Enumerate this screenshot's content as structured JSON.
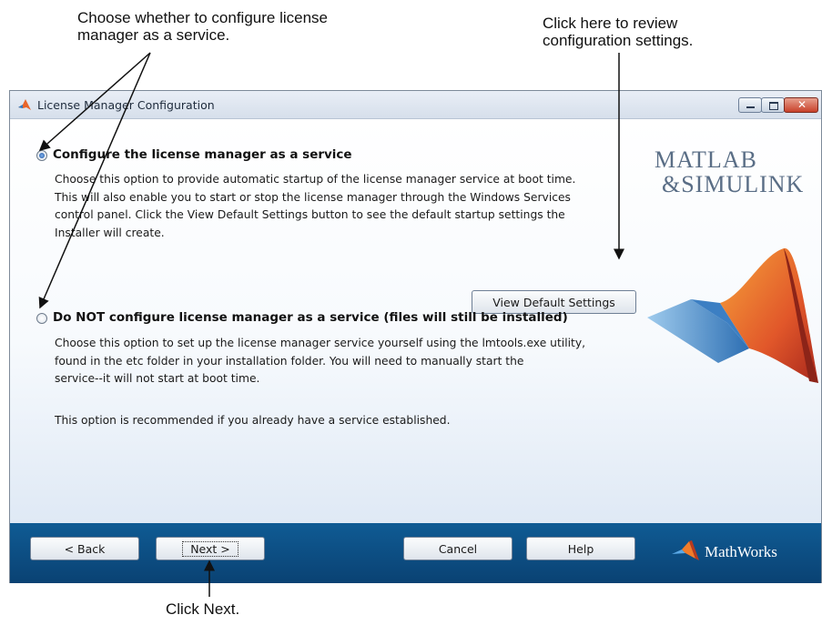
{
  "annotations": {
    "top_left": "Choose whether to configure license\nmanager as a service.",
    "top_right": "Click here to review\nconfiguration settings.",
    "bottom": "Click Next."
  },
  "window": {
    "title": "License Manager Configuration",
    "controls": [
      "minimize-icon",
      "maximize-icon",
      "close-icon"
    ]
  },
  "options": {
    "service": {
      "label": "Configure the license manager as a service",
      "selected": true,
      "description": "Choose this option to provide automatic startup of the license manager service at boot time.\nThis will also enable you to start or stop the license manager through the Windows Services\ncontrol panel. Click the View Default Settings button to see the default startup settings the\nInstaller will create.",
      "button": "View Default Settings"
    },
    "no_service": {
      "label": "Do NOT configure license manager as a service (files will still be installed)",
      "selected": false,
      "description": "Choose this option to set up the license manager service yourself using the lmtools.exe utility,\nfound in the etc folder in your installation folder. You will need to manually start the\nservice--it will not start at boot time.",
      "note": "This option is recommended if you already have a service established."
    }
  },
  "branding": {
    "logo_line1": "MATLAB",
    "logo_line2": "&SIMULINK",
    "footer_brand": "MathWorks",
    "accent_orange": "#e8652b",
    "footer_blue": "#0d4f86"
  },
  "footer": {
    "back": "< Back",
    "next": "Next >",
    "cancel": "Cancel",
    "help": "Help"
  }
}
